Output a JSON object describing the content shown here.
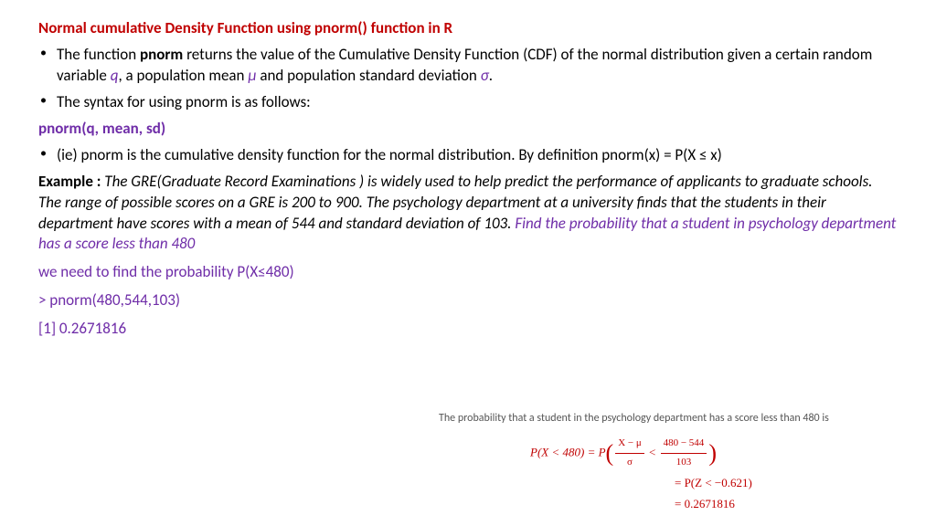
{
  "title": "Normal cumulative Density Function using pnorm() function in R",
  "bullets": {
    "b1a": "The function ",
    "b1b": "pnorm",
    "b1c": " returns the value of the Cumulative Density Function (CDF) of the normal distribution given a certain random variable ",
    "b1q": "q",
    "b1d": ", a population mean ",
    "b1mu": "μ",
    "b1e": " and population standard deviation ",
    "b1sigma": "σ",
    "b1f": ".",
    "b2": "The syntax for using pnorm is as follows:",
    "b3": "(ie) pnorm is the cumulative density function for the normal distribution. By definition pnorm(x) = P(X ≤ x)"
  },
  "syntax": "pnorm(q, mean, sd)",
  "example": {
    "label": "Example :",
    "body": "  The GRE(Graduate Record Examinations ) is widely used to help predict the performance of applicants to graduate schools. The range of possible scores on a GRE is 200 to 900. The psychology department at a university finds that the students in their department have scores with a mean of 544 and standard deviation of 103. ",
    "question": "Find the probability that a student in psychology department has a score less than 480"
  },
  "calc": {
    "line1": "we need to find the probability P(X≤480)",
    "line2": "> pnorm(480,544,103)",
    "line3": "[1] 0.2671816"
  },
  "mathnote": "The probability that a student in the psychology department has a score less than 480 is",
  "eq": {
    "lhs": "P(X < 480) = P",
    "frac1n": "X − μ",
    "frac1d": "σ",
    "lt": " < ",
    "frac2n": "480 − 544",
    "frac2d": "103",
    "l2": "= P(Z < −0.621)",
    "l3": "= 0.2671816"
  }
}
